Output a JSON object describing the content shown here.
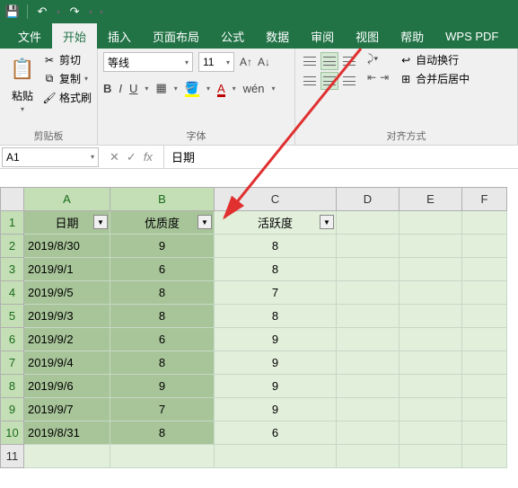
{
  "titlebar": {
    "save_icon": "💾",
    "undo_icon": "↶",
    "redo_icon": "↷"
  },
  "menu": {
    "file": "文件",
    "home": "开始",
    "insert": "插入",
    "page_layout": "页面布局",
    "formulas": "公式",
    "data": "数据",
    "review": "审阅",
    "view": "视图",
    "help": "帮助",
    "wps": "WPS PDF"
  },
  "ribbon": {
    "clipboard": {
      "label": "剪贴板",
      "paste": "粘贴",
      "cut": "剪切",
      "copy": "复制",
      "format_painter": "格式刷"
    },
    "font": {
      "label": "字体",
      "name": "等线",
      "size": "11",
      "bold": "B",
      "italic": "I",
      "underline": "U"
    },
    "alignment": {
      "label": "对齐方式",
      "wrap": "自动换行",
      "merge": "合并后居中"
    }
  },
  "namebox": "A1",
  "formula": "日期",
  "cols": [
    "A",
    "B",
    "C",
    "D",
    "E",
    "F"
  ],
  "rows": [
    "1",
    "2",
    "3",
    "4",
    "5",
    "6",
    "7",
    "8",
    "9",
    "10",
    "11"
  ],
  "headers": {
    "date": "日期",
    "quality": "优质度",
    "activity": "活跃度"
  },
  "data_rows": [
    {
      "date": "2019/8/30",
      "quality": "9",
      "activity": "8"
    },
    {
      "date": "2019/9/1",
      "quality": "6",
      "activity": "8"
    },
    {
      "date": "2019/9/5",
      "quality": "8",
      "activity": "7"
    },
    {
      "date": "2019/9/3",
      "quality": "8",
      "activity": "8"
    },
    {
      "date": "2019/9/2",
      "quality": "6",
      "activity": "9"
    },
    {
      "date": "2019/9/4",
      "quality": "8",
      "activity": "9"
    },
    {
      "date": "2019/9/6",
      "quality": "9",
      "activity": "9"
    },
    {
      "date": "2019/9/7",
      "quality": "7",
      "activity": "9"
    },
    {
      "date": "2019/8/31",
      "quality": "8",
      "activity": "6"
    }
  ]
}
